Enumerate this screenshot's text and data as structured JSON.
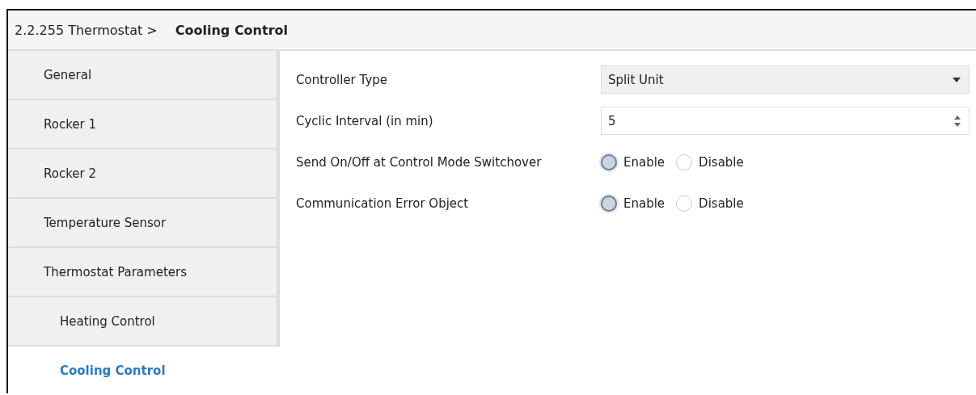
{
  "header": {
    "path": "2.2.255 Thermostat >",
    "current": "Cooling Control"
  },
  "sidebar": {
    "items": [
      {
        "label": "General",
        "selected": false
      },
      {
        "label": "Rocker 1",
        "selected": false
      },
      {
        "label": "Rocker 2",
        "selected": false
      },
      {
        "label": "Temperature Sensor",
        "selected": false
      },
      {
        "label": "Thermostat Parameters",
        "selected": false,
        "children": [
          {
            "label": "Heating Control",
            "selected": false
          },
          {
            "label": "Cooling Control",
            "selected": true
          }
        ]
      }
    ]
  },
  "parameters": [
    {
      "label": "Controller Type",
      "kind": "dropdown",
      "value": "Split Unit"
    },
    {
      "label": "Cyclic Interval (in min)",
      "kind": "spinner",
      "value": "5"
    },
    {
      "label": "Send On/Off at Control Mode Switchover",
      "kind": "radio",
      "options": [
        {
          "label": "Enable",
          "selected": true
        },
        {
          "label": "Disable",
          "selected": false
        }
      ]
    },
    {
      "label": "Communication Error Object",
      "kind": "radio",
      "options": [
        {
          "label": "Enable",
          "selected": true
        },
        {
          "label": "Disable",
          "selected": false
        }
      ]
    }
  ]
}
